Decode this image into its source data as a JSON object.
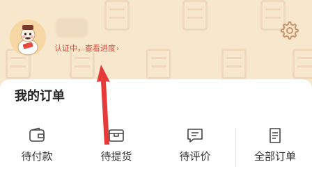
{
  "profile": {
    "verification_status": "认证中，查看进度",
    "chevron": "›"
  },
  "orders": {
    "title": "我的订单",
    "items": [
      {
        "label": "待付款",
        "icon": "wallet-icon"
      },
      {
        "label": "待提货",
        "icon": "box-icon"
      },
      {
        "label": "待评价",
        "icon": "comment-icon"
      },
      {
        "label": "全部订单",
        "icon": "document-list-icon"
      }
    ]
  },
  "colors": {
    "header_bg": "#f6e7cd",
    "status_red": "#d74b3f",
    "annotation_arrow": "#e63a3a"
  }
}
